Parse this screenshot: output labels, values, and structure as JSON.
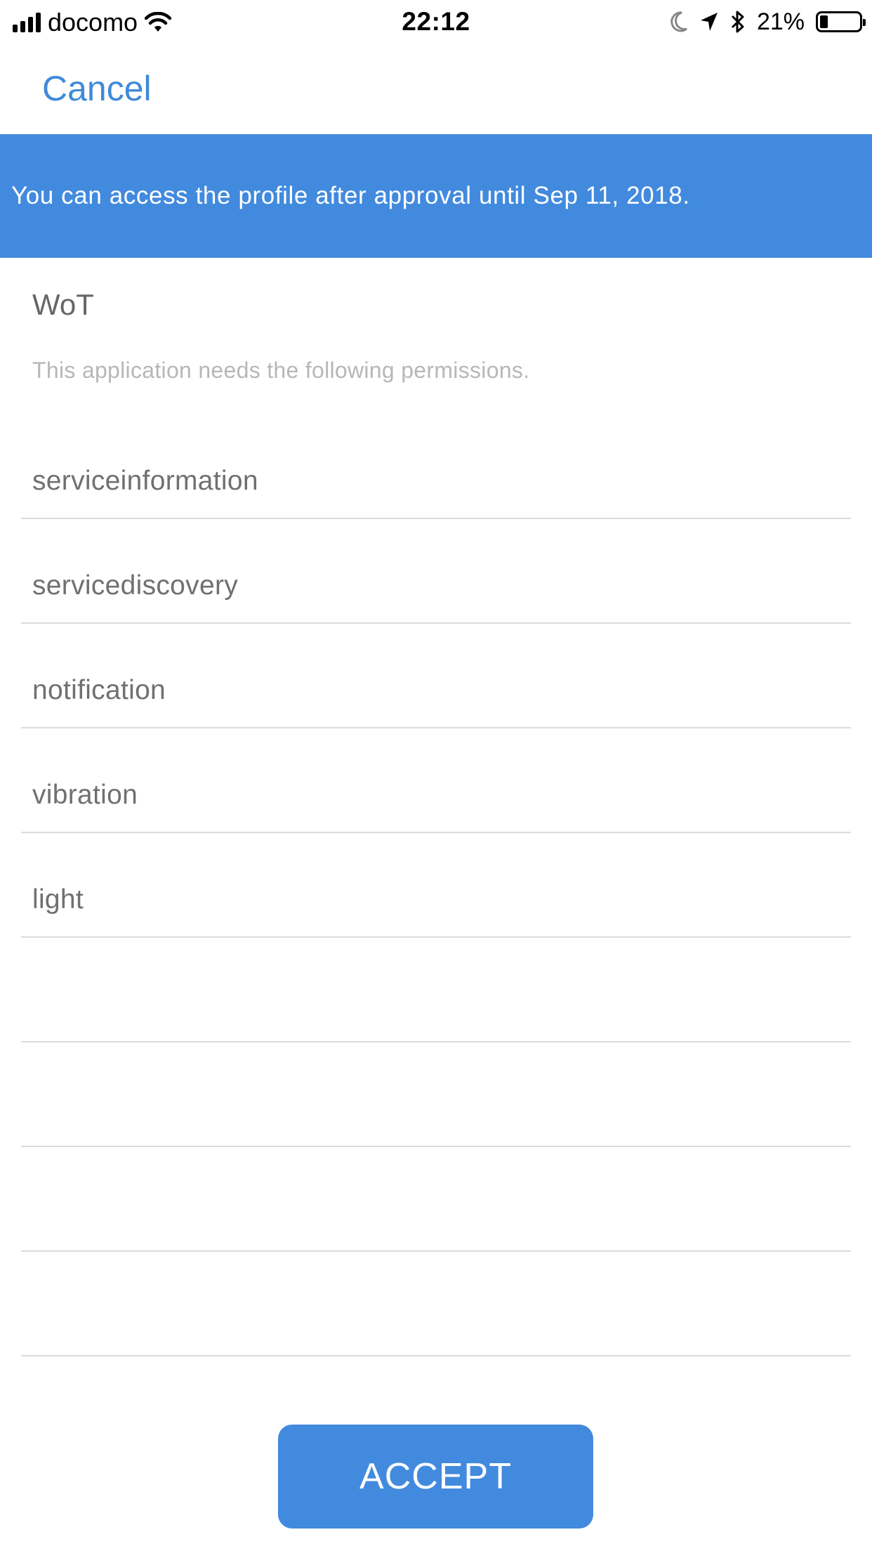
{
  "status_bar": {
    "carrier": "docomo",
    "time": "22:12",
    "battery_percent": "21%",
    "battery_level": 0.21,
    "icons": [
      "signal-icon",
      "wifi-icon",
      "moon-icon",
      "location-arrow-icon",
      "bluetooth-icon",
      "battery-icon"
    ]
  },
  "nav": {
    "cancel_label": "Cancel"
  },
  "banner": {
    "text": "You can access the profile after approval until Sep 11, 2018."
  },
  "app": {
    "name": "WoT",
    "permissions_intro": "This application needs the following permissions."
  },
  "permissions": [
    "serviceinformation",
    "servicediscovery",
    "notification",
    "vibration",
    "light",
    "",
    "",
    "",
    ""
  ],
  "actions": {
    "accept_label": "ACCEPT"
  },
  "colors": {
    "accent": "#428ade",
    "link": "#3f8ad9"
  }
}
